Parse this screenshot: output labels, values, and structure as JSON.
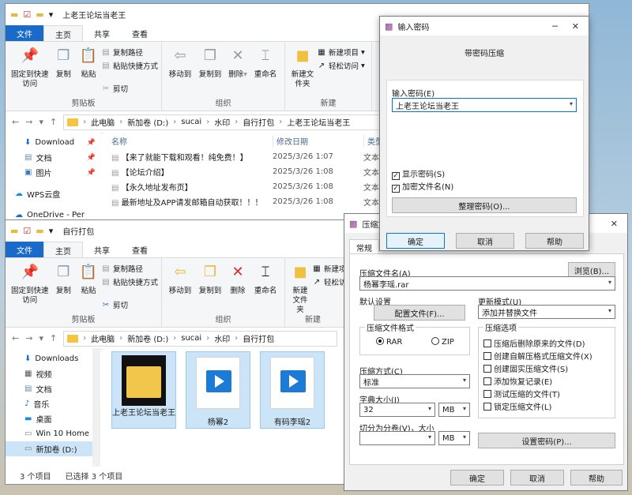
{
  "explorer_top": {
    "title": "上老王论坛当老王",
    "tabs": [
      "文件",
      "主页",
      "共享",
      "查看"
    ],
    "ribbon": {
      "clipboard": {
        "pin": "固定到快速访问",
        "copy": "复制",
        "paste": "粘贴",
        "copy_path": "复制路径",
        "paste_shortcut": "粘贴快捷方式",
        "cut": "剪切",
        "label": "剪贴板"
      },
      "organize": {
        "move_to": "移动到",
        "copy_to": "复制到",
        "delete": "删除",
        "rename": "重命名",
        "label": "组织"
      },
      "new": {
        "new_folder": "新建文件夹",
        "new_item": "新建项目",
        "easy_access": "轻松访问",
        "label": "新建"
      }
    },
    "breadcrumbs": [
      "此电脑",
      "新加卷 (D:)",
      "sucai",
      "水印",
      "自行打包",
      "上老王论坛当老王"
    ],
    "nav": [
      {
        "label": "Download",
        "pinned": true
      },
      {
        "label": "文档",
        "pinned": true
      },
      {
        "label": "图片",
        "pinned": true
      },
      {
        "label": "WPS云盘",
        "pinned": false
      },
      {
        "label": "OneDrive - Per",
        "pinned": false
      }
    ],
    "columns": {
      "name": "名称",
      "date": "修改日期",
      "type": "类型"
    },
    "files": [
      {
        "name": "【来了就能下载和观看！纯免费！】",
        "date": "2025/3/26 1:07",
        "type": "文本"
      },
      {
        "name": "【论坛介绍】",
        "date": "2025/3/26 1:08",
        "type": "文本"
      },
      {
        "name": "【永久地址发布页】",
        "date": "2025/3/26 1:08",
        "type": "文本"
      },
      {
        "name": "最新地址及APP请发邮箱自动获取！！！",
        "date": "2025/3/26 1:08",
        "type": "文本"
      }
    ]
  },
  "explorer_bottom": {
    "title": "自行打包",
    "tabs": [
      "文件",
      "主页",
      "共享",
      "查看"
    ],
    "breadcrumbs": [
      "此电脑",
      "新加卷 (D:)",
      "sucai",
      "水印",
      "自行打包"
    ],
    "nav": [
      "Downloads",
      "视频",
      "文档",
      "音乐",
      "桌面",
      "Win 10 Home",
      "新加卷 (D:)"
    ],
    "items": [
      {
        "name": "上老王论坛当老王",
        "kind": "folder"
      },
      {
        "name": "杨幂2",
        "kind": "video"
      },
      {
        "name": "有码李瑶2",
        "kind": "video"
      }
    ],
    "status": {
      "count": "3 个项目",
      "selected": "已选择 3 个项目"
    }
  },
  "password_dialog": {
    "title": "输入密码",
    "heading": "带密码压缩",
    "password_label": "输入密码(E)",
    "password_value": "上老王论坛当老王",
    "show_password": {
      "label": "显示密码(S)",
      "checked": true
    },
    "encrypt_names": {
      "label": "加密文件名(N)",
      "checked": true
    },
    "organize_button": "整理密码(O)...",
    "ok": "确定",
    "cancel": "取消",
    "help": "帮助"
  },
  "archive_dialog": {
    "title": "压缩文",
    "tab": "常规",
    "filename_label": "压缩文件名(A)",
    "browse": "浏览(B)...",
    "filename_value": "杨幂李瑶.rar",
    "defaults_label": "默认设置",
    "profiles_button": "配置文件(F)...",
    "update_label": "更新模式(U)",
    "update_value": "添加并替换文件",
    "format_label": "压缩文件格式",
    "format_rar": "RAR",
    "format_zip": "ZIP",
    "method_label": "压缩方式(C)",
    "method_value": "标准",
    "dict_label": "字典大小(I)",
    "dict_value": "32",
    "dict_unit": "MB",
    "split_label": "切分为分卷(V)，大小",
    "split_value": "",
    "split_unit": "MB",
    "options_label": "压缩选项",
    "options": [
      "压缩后删除原来的文件(D)",
      "创建自解压格式压缩文件(X)",
      "创建固实压缩文件(S)",
      "添加恢复记录(E)",
      "测试压缩的文件(T)",
      "锁定压缩文件(L)"
    ],
    "set_password": "设置密码(P)...",
    "ok": "确定",
    "cancel": "取消",
    "help": "帮助"
  }
}
